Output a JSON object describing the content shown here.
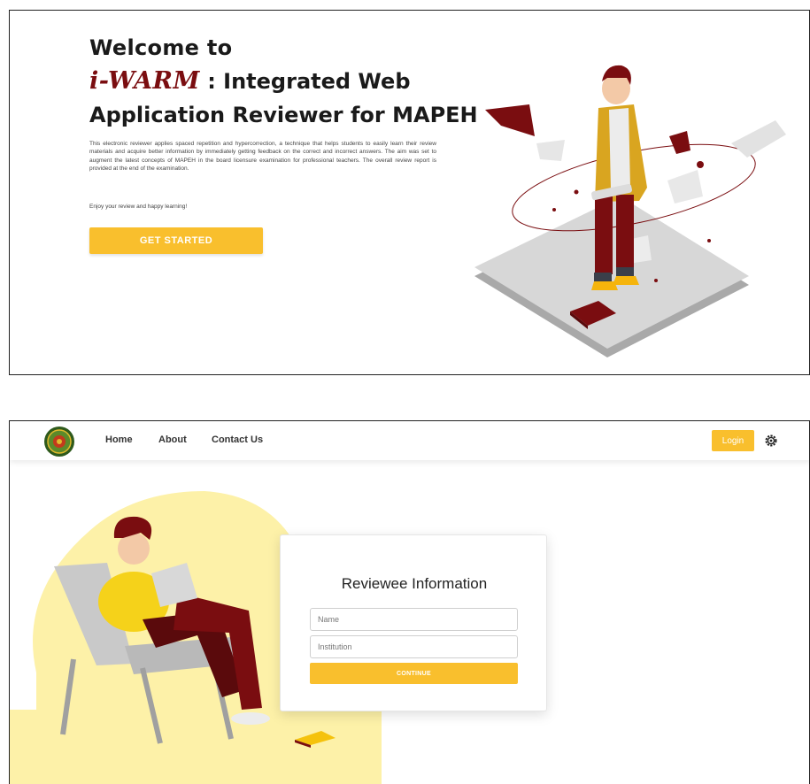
{
  "landing": {
    "welcome": "Welcome to",
    "brand": "i-WARM",
    "title_rest": " : Integrated Web",
    "title_line3": "Application Reviewer for MAPEH",
    "description": "This electronic reviewer applies spaced repetition and hypercorrection, a technique that helps students to easily learn their review materials and acquire better information by immediately getting feedback on the correct and incorrect answers. The aim was set to augment the latest concepts of MAPEH in the board licensure examination for professional teachers. The overall review report is provided at the end of the examination.",
    "enjoy": "Enjoy your review and happy learning!",
    "cta": "GET STARTED"
  },
  "nav": {
    "items": [
      "Home",
      "About",
      "Contact Us"
    ],
    "login": "Login"
  },
  "form": {
    "title": "Reviewee Information",
    "name_placeholder": "Name",
    "institution_placeholder": "Institution",
    "continue": "CONTINUE"
  },
  "colors": {
    "accent": "#f9bf2d",
    "brand": "#7a0d10",
    "blob": "#fdf1a8"
  },
  "icons": [
    "logo-seal-icon",
    "gear-icon"
  ]
}
